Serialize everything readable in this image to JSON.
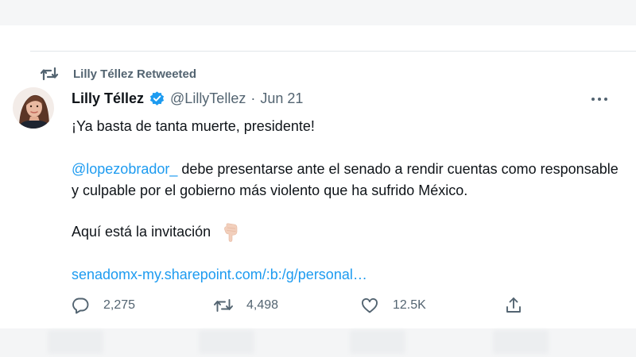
{
  "retweet_context": {
    "label": "Lilly Téllez Retweeted"
  },
  "author": {
    "name": "Lilly Téllez",
    "handle": "@LillyTellez",
    "separator": "·",
    "date": "Jun 21"
  },
  "tweet": {
    "line1": "¡Ya basta de tanta muerte, presidente!",
    "mention": "@lopezobrador_",
    "line2_rest": " debe presentarse ante el senado a rendir cuentas como responsable y culpable por el gobierno más violento que ha sufrido México.",
    "line3": "Aquí está la invitación",
    "link": "senadomx-my.sharepoint.com/:b:/g/personal…"
  },
  "actions": {
    "replies": "2,275",
    "retweets": "4,498",
    "likes": "12.5K"
  },
  "colors": {
    "text": "#0f1419",
    "secondary": "#536471",
    "link": "#1d9bf0",
    "verified": "#1d9bf0"
  },
  "icons": [
    "retweet-icon",
    "verified-badge-icon",
    "more-icon",
    "pointing-down-hand-icon",
    "reply-icon",
    "like-icon",
    "share-icon"
  ]
}
